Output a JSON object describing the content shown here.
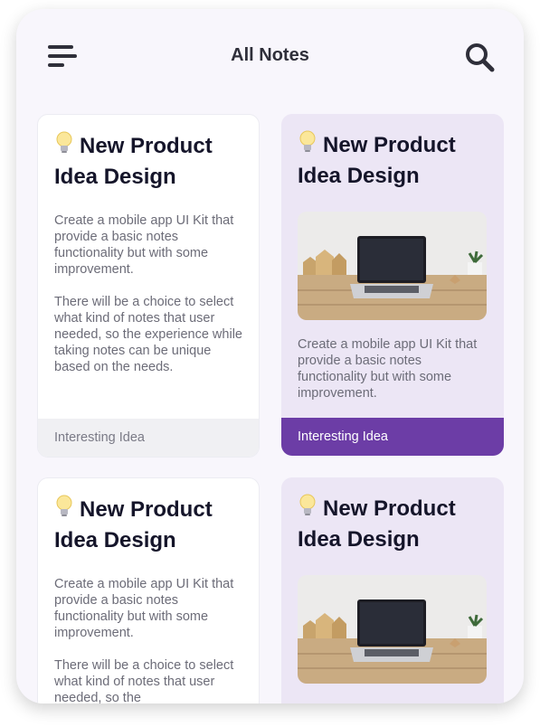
{
  "header": {
    "title": "All Notes",
    "menu_icon": "menu-icon",
    "search_icon": "search-icon"
  },
  "colors": {
    "accent": "#6c3da6",
    "card_purple_bg": "#ece6f5",
    "text_dark": "#15152a"
  },
  "notes": [
    {
      "title": "New Product Idea Design",
      "body": "Create a mobile app UI Kit that provide a basic notes functionality but with some improvement.\n\nThere will be a choice to select what kind of notes that user needed, so the experience while taking notes can be unique based on the needs.",
      "tag": "Interesting Idea"
    },
    {
      "title": "New Product Idea Design",
      "body": "Create a mobile app UI Kit that provide a basic notes functionality but with some improvement.",
      "tag": "Interesting Idea",
      "image": "laptop-on-desk-photo"
    },
    {
      "title": "New Product Idea Design",
      "body": "Create a mobile app UI Kit that provide a basic notes functionality but with some improvement.\n\nThere will be a choice to select what kind of notes that user needed, so the"
    },
    {
      "title": "New Product Idea Design",
      "image": "laptop-on-desk-photo"
    }
  ]
}
